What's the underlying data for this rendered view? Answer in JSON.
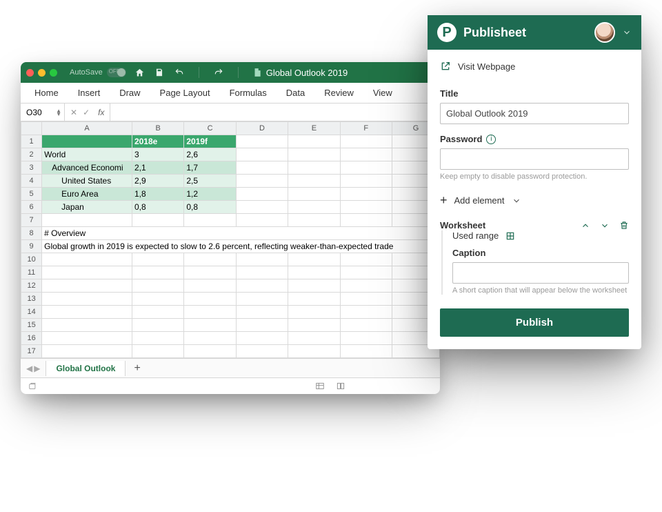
{
  "excel": {
    "autosave_label": "AutoSave",
    "autosave_state": "OFF",
    "doc_title": "Global Outlook 2019",
    "ribbon_tabs": [
      "Home",
      "Insert",
      "Draw",
      "Page Layout",
      "Formulas",
      "Data",
      "Review",
      "View"
    ],
    "name_box": "O30",
    "fx_label": "fx",
    "columns": [
      "A",
      "B",
      "C",
      "D",
      "E",
      "F",
      "G"
    ],
    "header_row": {
      "col_b": "2018e",
      "col_c": "2019f"
    },
    "rows": [
      {
        "n": 2,
        "label": "World",
        "indent": 0,
        "b": "3",
        "c": "2,6",
        "shade": "odd"
      },
      {
        "n": 3,
        "label": "Advanced Economies",
        "truncated": "Advanced Economi",
        "indent": 1,
        "b": "2,1",
        "c": "1,7",
        "shade": "even"
      },
      {
        "n": 4,
        "label": "United States",
        "indent": 2,
        "b": "2,9",
        "c": "2,5",
        "shade": "odd"
      },
      {
        "n": 5,
        "label": "Euro Area",
        "indent": 2,
        "b": "1,8",
        "c": "1,2",
        "shade": "even"
      },
      {
        "n": 6,
        "label": "Japan",
        "indent": 2,
        "b": "0,8",
        "c": "0,8",
        "shade": "odd"
      }
    ],
    "overview_heading": "# Overview",
    "overview_text": "Global growth in 2019 is expected to slow to 2.6 percent, reflecting weaker-than-expected trade",
    "sheet_tab": "Global Outlook"
  },
  "panel": {
    "brand": "Publisheet",
    "visit_webpage": "Visit Webpage",
    "title_label": "Title",
    "title_value": "Global Outlook 2019",
    "password_label": "Password",
    "password_hint": "Keep empty to disable password protection.",
    "add_element": "Add element",
    "worksheet_label": "Worksheet",
    "used_range": "Used range",
    "caption_label": "Caption",
    "caption_hint": "A short caption that will appear below the worksheet",
    "publish": "Publish"
  }
}
